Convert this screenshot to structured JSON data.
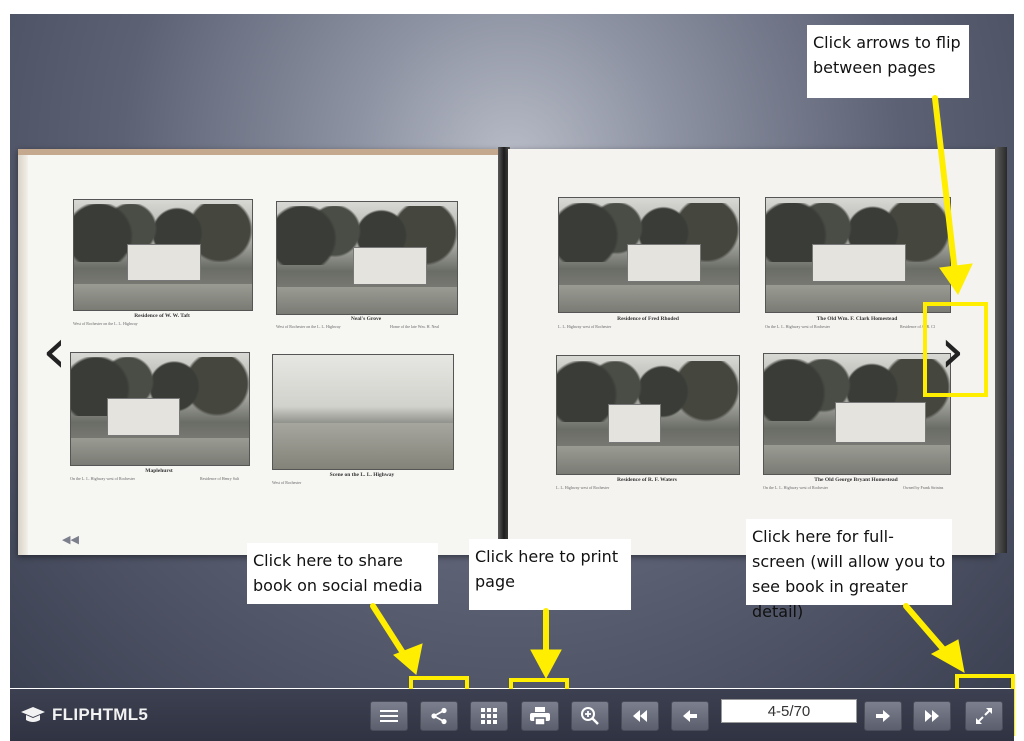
{
  "book": {
    "left_page": {
      "photos": [
        {
          "caption": "Residence of W. W. Taft",
          "sub_left": "West of Rochester on the L. L. Highway",
          "sub_right": ""
        },
        {
          "caption": "Neal's Grove",
          "sub_left": "West of Rochester on the L. L. Highway",
          "sub_right": "Home of the late Wm. H. Neal"
        },
        {
          "caption": "Maplehurst",
          "sub_left": "On the L. L. Highway west of Rochester",
          "sub_right": "Residence of Henry Salt"
        },
        {
          "caption": "Scene on the L. L. Highway",
          "sub_left": "West of Rochester",
          "sub_right": ""
        }
      ]
    },
    "right_page": {
      "photos": [
        {
          "caption": "Residence of Fred Rhoded",
          "sub_left": "L. L. Highway west of Rochester",
          "sub_right": ""
        },
        {
          "caption": "The Old Wm. F. Clark Homestead",
          "sub_left": "On the L. L. Highway west of Rochester",
          "sub_right": "Residence of A. R. Cl"
        },
        {
          "caption": "Residence of R. F. Waters",
          "sub_left": "L. L. Highway west of Rochester",
          "sub_right": ""
        },
        {
          "caption": "The Old George Bryant Homestead",
          "sub_left": "On the L. L. Highway west of Rochester",
          "sub_right": "Owned by Frank Strinins"
        }
      ]
    }
  },
  "callouts": {
    "flip": "Click arrows to flip between pages",
    "share": "Click here to share book on social media",
    "print": "Click here to print page",
    "fullscreen": "Click here for full-screen (will allow you to see book in greater detail)"
  },
  "toolbar": {
    "logo_text": "FLIPHTML5",
    "page_value": "4-5/70",
    "buttons": [
      "table-of-contents-icon",
      "share-icon",
      "thumbnails-icon",
      "print-icon",
      "zoom-in-icon",
      "first-page-icon",
      "previous-page-icon",
      "next-page-icon",
      "last-page-icon",
      "fullscreen-icon"
    ]
  },
  "colors": {
    "highlight": "#ffee00",
    "toolbar_bg": "#2f3342",
    "button_bg": "#6b6f7d"
  }
}
